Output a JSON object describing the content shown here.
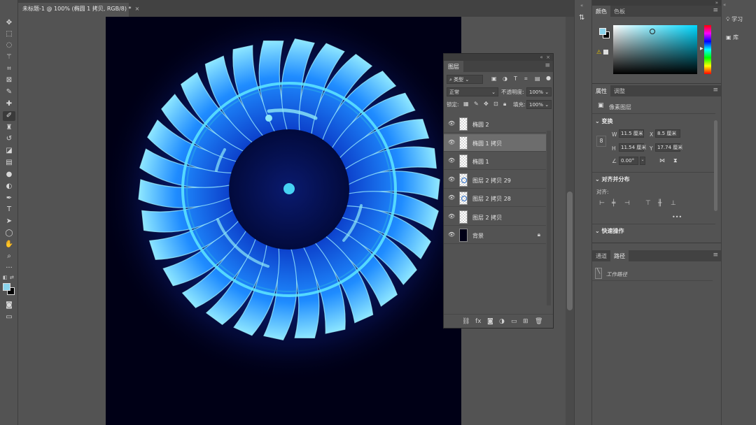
{
  "document": {
    "tab_title": "未标题-1 @ 100% (椭圆 1 拷贝, RGB/8) *",
    "close_glyph": "×"
  },
  "toolbar": {
    "tools": [
      "move-tool",
      "marquee-tool",
      "lasso-tool",
      "magic-wand-tool",
      "crop-tool",
      "frame-tool",
      "eyedropper-tool",
      "healing-brush-tool",
      "brush-tool",
      "clone-stamp-tool",
      "history-brush-tool",
      "eraser-tool",
      "gradient-tool",
      "blur-tool",
      "dodge-tool",
      "pen-tool",
      "type-tool",
      "path-selection-tool",
      "ellipse-tool",
      "hand-tool",
      "zoom-tool",
      "more-tools"
    ],
    "active_tool": "brush-tool",
    "foreground_color": "#8ad4ec",
    "background_color": "#000000"
  },
  "layers_panel": {
    "title": "图层",
    "filter_label": "类型",
    "blend_mode": "正常",
    "opacity_label": "不透明度:",
    "opacity_value": "100%",
    "lock_label": "锁定:",
    "fill_label": "填充:",
    "fill_value": "100%",
    "layers": [
      {
        "name": "椭圆 2",
        "selected": false,
        "thumb": "shape"
      },
      {
        "name": "椭圆 1 拷贝",
        "selected": true,
        "thumb": "transparent"
      },
      {
        "name": "椭圆 1",
        "selected": false,
        "thumb": "transparent"
      },
      {
        "name": "图层 2 拷贝 29",
        "selected": false,
        "thumb": "ring"
      },
      {
        "name": "图层 2 拷贝 28",
        "selected": false,
        "thumb": "ring"
      },
      {
        "name": "图层 2 拷贝",
        "selected": false,
        "thumb": "transparent"
      },
      {
        "name": "背景",
        "selected": false,
        "thumb": "background",
        "locked": true
      }
    ],
    "footer_icons": [
      "link-icon",
      "fx-icon",
      "mask-icon",
      "adjustment-icon",
      "group-icon",
      "new-layer-icon",
      "trash-icon"
    ]
  },
  "color_panel": {
    "tabs": [
      "颜色",
      "色板"
    ],
    "active_tab": "颜色",
    "hue_color": "#00d8ff"
  },
  "properties_panel": {
    "tabs": [
      "属性",
      "调整"
    ],
    "active_tab": "属性",
    "layer_kind": "像素图层",
    "transform_title": "变换",
    "w_label": "W",
    "w_value": "11.5 厘米",
    "x_label": "X",
    "x_value": "8.5 厘米",
    "h_label": "H",
    "h_value": "11.54 厘米",
    "y_label": "Y",
    "y_value": "17.74 厘米",
    "angle_value": "0.00°",
    "align_title": "对齐并分布",
    "align_label": "对齐:",
    "more_glyph": "•••",
    "quick_title": "快速操作"
  },
  "paths_panel": {
    "tabs": [
      "通道",
      "路径"
    ],
    "active_tab": "路径",
    "items": [
      "工作路径"
    ]
  },
  "dock": {
    "learn_label": "学习",
    "library_label": "库"
  }
}
